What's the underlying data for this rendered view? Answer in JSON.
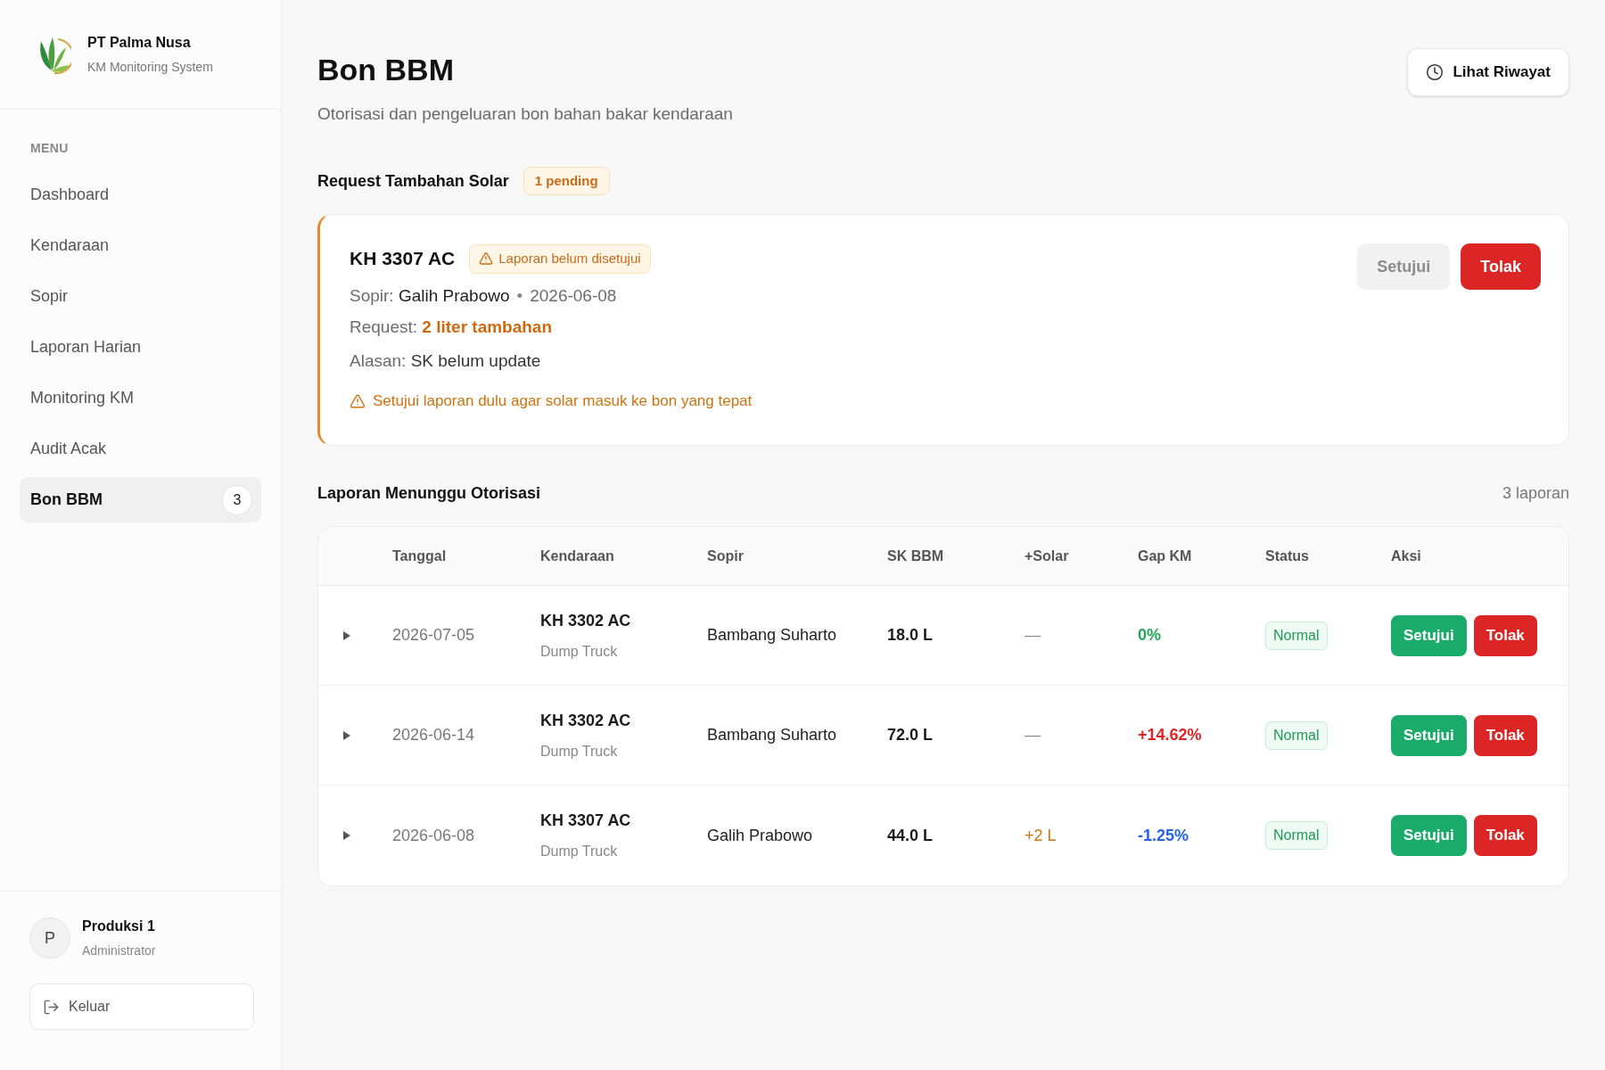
{
  "sidebar": {
    "brand": {
      "name": "PT Palma Nusa",
      "subtitle": "KM Monitoring System"
    },
    "menu_label": "MENU",
    "items": [
      {
        "label": "Dashboard",
        "selected": false
      },
      {
        "label": "Kendaraan",
        "selected": false
      },
      {
        "label": "Sopir",
        "selected": false
      },
      {
        "label": "Laporan Harian",
        "selected": false
      },
      {
        "label": "Monitoring KM",
        "selected": false
      },
      {
        "label": "Audit Acak",
        "selected": false
      },
      {
        "label": "Bon BBM",
        "selected": true,
        "badge": "3"
      }
    ],
    "user": {
      "initial": "P",
      "name": "Produksi 1",
      "role": "Administrator"
    },
    "logout": {
      "label": "Keluar"
    }
  },
  "header": {
    "title": "Bon BBM",
    "subtitle": "Otorisasi dan pengeluaran bon bahan bakar kendaraan",
    "history_button": "Lihat Riwayat"
  },
  "requests": {
    "title": "Request Tambahan Solar",
    "badge": "1 pending",
    "cards": [
      {
        "plate": "KH 3307 AC",
        "status": "Laporan belum disetujui",
        "driver_label": "Sopir:",
        "driver": "Galih Prabowo",
        "separator": "•",
        "date": "2026-06-08",
        "request_label": "Request:",
        "request": "2 liter tambahan",
        "reason_label": "Alasan:",
        "reason": "SK belum update",
        "warning": "Setujui laporan dulu agar solar masuk ke bon yang tepat",
        "buttons": [
          {
            "label": "Setujui",
            "kind": "approve",
            "disabled": true
          },
          {
            "label": "Tolak",
            "kind": "reject",
            "disabled": false
          }
        ]
      }
    ]
  },
  "reports": {
    "title": "Laporan Menunggu Otorisasi",
    "count": "3 laporan",
    "table": {
      "columns": [
        "Tanggal",
        "Kendaraan",
        "Sopir",
        "SK BBM",
        "+Solar",
        "Gap KM",
        "Status",
        "Aksi"
      ],
      "rows": [
        {
          "expanded": false,
          "date": "2026-07-05",
          "plate": "KH 3302 AC",
          "vehicle_type": "Dump Truck",
          "driver": "Bambang Suharto",
          "sk_bbm": "18.0 L",
          "solar": {
            "text": "—",
            "color": "#8a8a8a"
          },
          "gap_km": {
            "text": "0%",
            "color": "#22a55a"
          },
          "status": "Normal",
          "actions": [
            {
              "label": "Setujui",
              "kind": "approve",
              "disabled": false
            },
            {
              "label": "Tolak",
              "kind": "reject",
              "disabled": false
            }
          ]
        },
        {
          "expanded": false,
          "date": "2026-06-14",
          "plate": "KH 3302 AC",
          "vehicle_type": "Dump Truck",
          "driver": "Bambang Suharto",
          "sk_bbm": "72.0 L",
          "solar": {
            "text": "—",
            "color": "#8a8a8a"
          },
          "gap_km": {
            "text": "+14.62%",
            "color": "#dc2626"
          },
          "status": "Normal",
          "actions": [
            {
              "label": "Setujui",
              "kind": "approve",
              "disabled": false
            },
            {
              "label": "Tolak",
              "kind": "reject",
              "disabled": false
            }
          ]
        },
        {
          "expanded": false,
          "date": "2026-06-08",
          "plate": "KH 3307 AC",
          "vehicle_type": "Dump Truck",
          "driver": "Galih Prabowo",
          "sk_bbm": "44.0 L",
          "solar": {
            "text": "+2 L",
            "color": "#d0730f"
          },
          "gap_km": {
            "text": "-1.25%",
            "color": "#2563eb"
          },
          "status": "Normal",
          "actions": [
            {
              "label": "Setujui",
              "kind": "approve",
              "disabled": false
            },
            {
              "label": "Tolak",
              "kind": "reject",
              "disabled": false
            }
          ]
        }
      ]
    }
  }
}
